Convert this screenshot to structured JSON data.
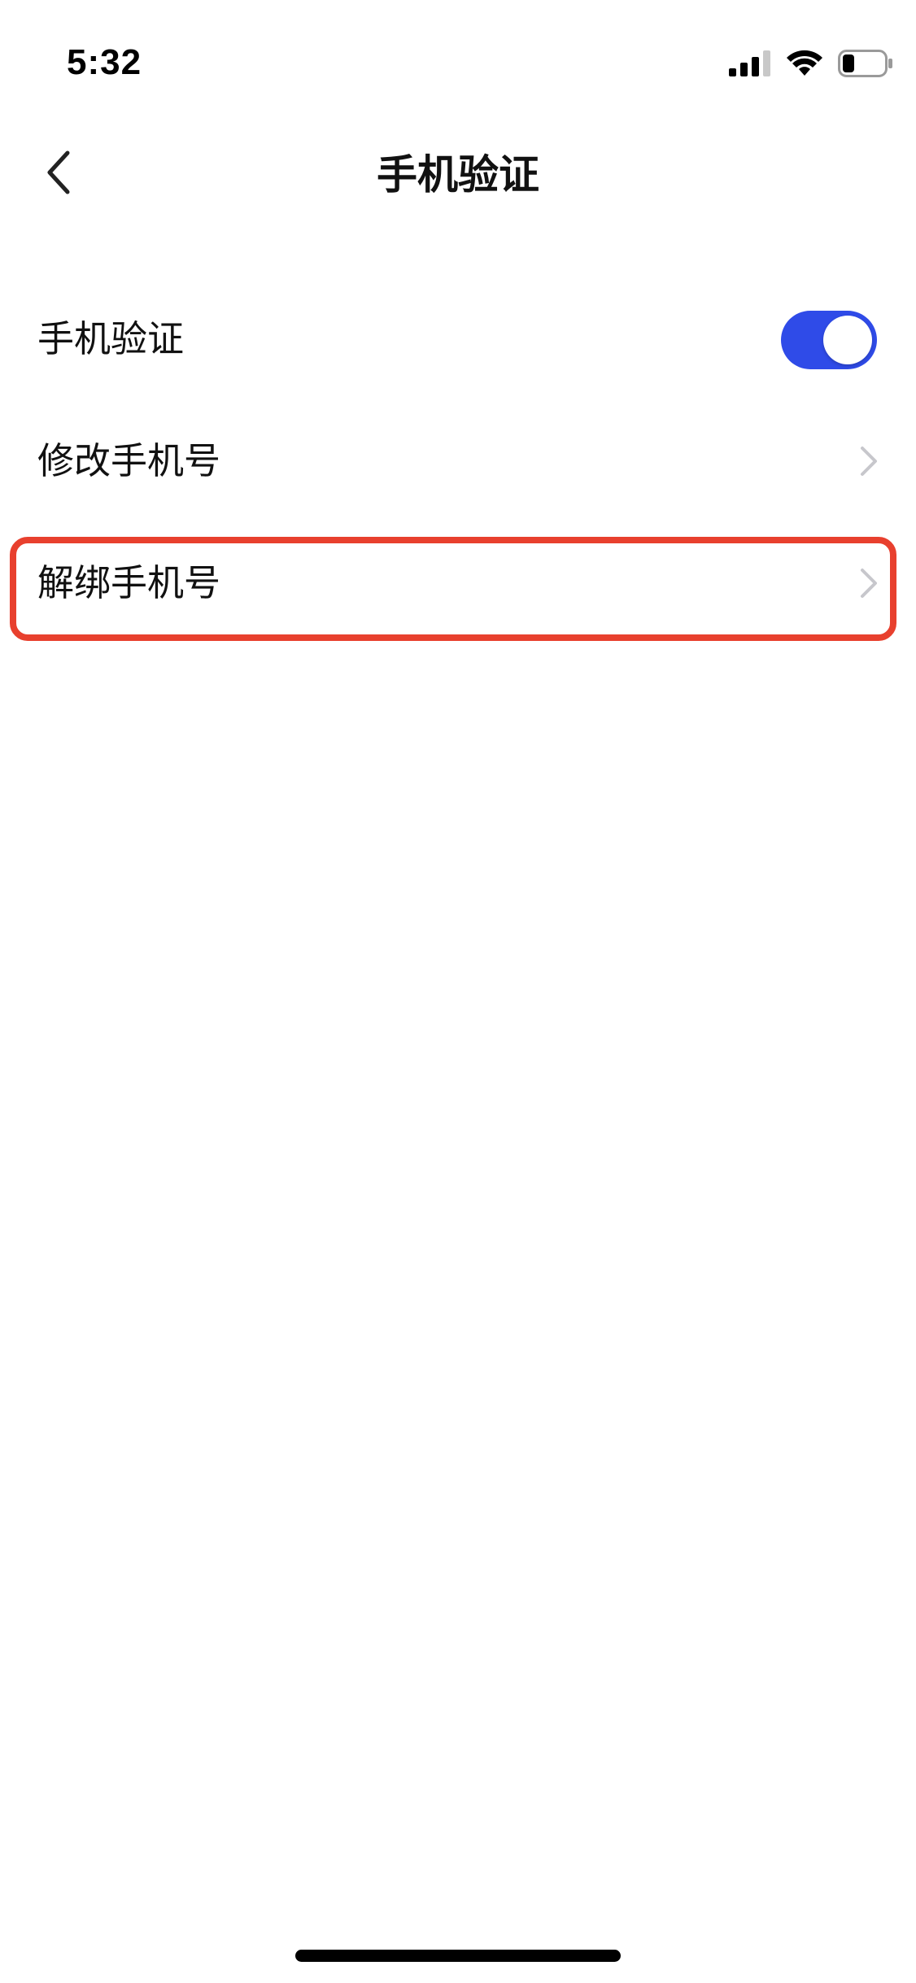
{
  "status_bar": {
    "time": "5:32",
    "icons": [
      "signal-icon",
      "wifi-icon",
      "battery-icon"
    ],
    "battery_level": 0.25
  },
  "nav": {
    "back_icon": "chevron-left-icon",
    "title": "手机验证"
  },
  "settings": {
    "rows": [
      {
        "label": "手机验证",
        "control": "toggle",
        "toggle_on": true
      },
      {
        "label": "修改手机号",
        "control": "chevron"
      },
      {
        "label": "解绑手机号",
        "control": "chevron",
        "highlighted": true
      }
    ]
  },
  "colors": {
    "toggle_on": "#2f4be8",
    "highlight": "#e8402e",
    "chevron": "#c7c7cc"
  }
}
